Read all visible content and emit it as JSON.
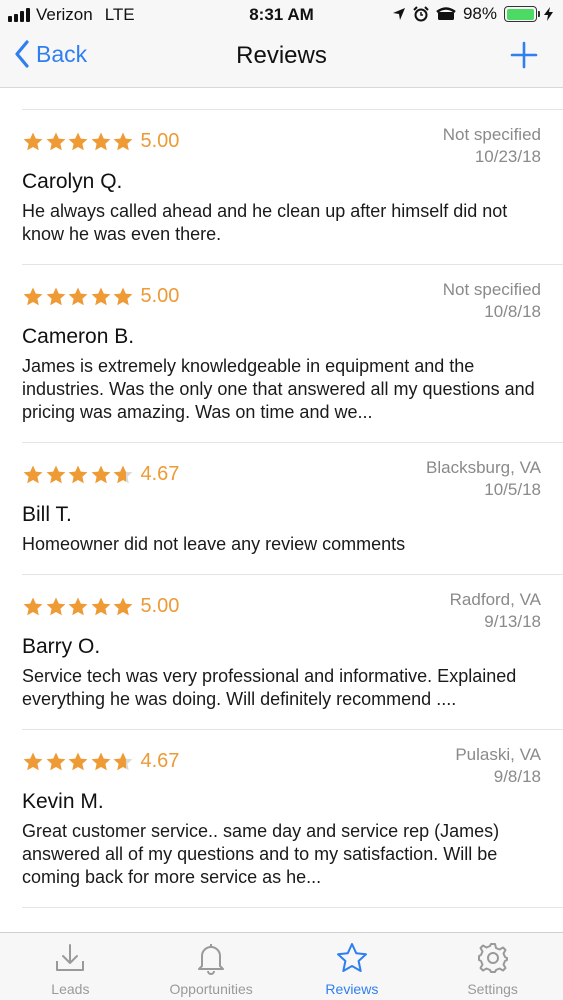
{
  "status_bar": {
    "carrier": "Verizon",
    "network": "LTE",
    "time": "8:31 AM",
    "battery_percent": "98%",
    "battery_level": 0.98,
    "icons": [
      "location-icon",
      "alarm-icon",
      "tty-icon",
      "battery-icon",
      "charging-icon"
    ]
  },
  "nav": {
    "back_label": "Back",
    "title": "Reviews",
    "accent_color": "#2f7ff0"
  },
  "reviews": [
    {
      "rating_value": 5.0,
      "rating_text": "5.00",
      "location": "Not specified",
      "date": "10/23/18",
      "name": "Carolyn Q.",
      "comment": "He always called ahead and he clean up after himself did not know he was even there."
    },
    {
      "rating_value": 5.0,
      "rating_text": "5.00",
      "location": "Not specified",
      "date": "10/8/18",
      "name": "Cameron B.",
      "comment": "James is extremely knowledgeable in equipment and the industries. Was the only one that answered all my questions and pricing was amazing. Was on time and we..."
    },
    {
      "rating_value": 4.67,
      "rating_text": "4.67",
      "location": "Blacksburg, VA",
      "date": "10/5/18",
      "name": "Bill T.",
      "comment": "Homeowner did not leave any review comments"
    },
    {
      "rating_value": 5.0,
      "rating_text": "5.00",
      "location": "Radford, VA",
      "date": "9/13/18",
      "name": "Barry O.",
      "comment": "Service tech was very professional and informative. Explained everything he was doing.  Will definitely recommend ...."
    },
    {
      "rating_value": 4.67,
      "rating_text": "4.67",
      "location": "Pulaski, VA",
      "date": "9/8/18",
      "name": "Kevin M.",
      "comment": "Great customer service.. same day and service rep (James) answered all of my questions and to my satisfaction.    Will be coming back for more service as he..."
    }
  ],
  "star_color": "#ee9a35",
  "tabs": [
    {
      "label": "Leads",
      "icon": "download-icon",
      "active": false
    },
    {
      "label": "Opportunities",
      "icon": "bell-icon",
      "active": false
    },
    {
      "label": "Reviews",
      "icon": "star-icon",
      "active": true
    },
    {
      "label": "Settings",
      "icon": "gear-icon",
      "active": false
    }
  ]
}
